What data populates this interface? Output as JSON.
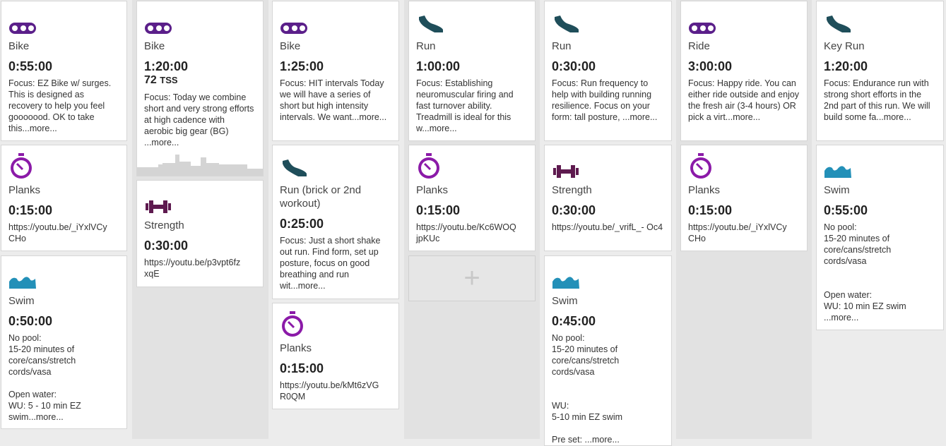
{
  "colors": {
    "bike": "#5b1f8a",
    "run": "#1f4e5a",
    "timer": "#8b1aa8",
    "strength": "#5e1a4f",
    "swim": "#2390b8"
  },
  "days": [
    {
      "cards": [
        {
          "icon": "bike-chain-icon",
          "title": "Bike",
          "duration": "0:55:00",
          "desc": "Focus: EZ Bike w/ surges. This is designed as recovery to help you feel gooooood. OK to take this",
          "more": "...more..."
        },
        {
          "icon": "stopwatch-icon",
          "title": "Planks",
          "duration": "0:15:00",
          "desc": "https://youtu.be/_iYxlVCy CHo"
        },
        {
          "icon": "swim-wave-icon",
          "title": "Swim",
          "duration": "0:50:00",
          "desc": "No pool:\n15-20 minutes of core/cans/stretch cords/vasa\n\nOpen water:\nWU: 5 - 10 min EZ swim",
          "more": "...more..."
        }
      ]
    },
    {
      "cards": [
        {
          "icon": "bike-chain-icon",
          "title": "Bike",
          "duration": "1:20:00",
          "tss": "72",
          "tss_unit": "TSS",
          "desc": "Focus: Today we combine short and very strong efforts at high cadence with aerobic big gear (BG) ",
          "more": "...more..."
        },
        {
          "icon": "dumbbell-icon",
          "title": "Strength",
          "duration": "0:30:00",
          "desc": "https://youtu.be/p3vpt6fz xqE"
        }
      ]
    },
    {
      "cards": [
        {
          "icon": "bike-chain-icon",
          "title": "Bike",
          "duration": "1:25:00",
          "desc": "Focus: HIT intervals Today we will have a series of short but high intensity intervals. We want",
          "more": "...more..."
        },
        {
          "icon": "run-shoe-icon",
          "title": "Run (brick or 2nd workout)",
          "duration": "0:25:00",
          "desc": "Focus: Just a short shake out run. Find form, set up posture, focus on good breathing and run wit",
          "more": "...more..."
        },
        {
          "icon": "stopwatch-icon",
          "title": "Planks",
          "duration": "0:15:00",
          "desc": "https://youtu.be/kMt6zVG R0QM"
        }
      ]
    },
    {
      "cards": [
        {
          "icon": "run-shoe-icon",
          "title": "Run",
          "duration": "1:00:00",
          "desc": "Focus: Establishing neuromuscular firing and fast turnover ability. Treadmill is ideal for this w",
          "more": "...more..."
        },
        {
          "icon": "stopwatch-icon",
          "title": "Planks",
          "duration": "0:15:00",
          "desc": "https://youtu.be/Kc6WOQ jpKUc"
        }
      ],
      "add_label": "+"
    },
    {
      "cards": [
        {
          "icon": "run-shoe-icon",
          "title": "Run",
          "duration": "0:30:00",
          "desc": "Focus: Run frequency to help with building running resilience. Focus on your form: tall posture, ",
          "more": "...more..."
        },
        {
          "icon": "dumbbell-icon",
          "title": "Strength",
          "duration": "0:30:00",
          "desc": "https://youtu.be/_vrifL_- Oc4"
        },
        {
          "icon": "swim-wave-icon",
          "title": "Swim",
          "duration": "0:45:00",
          "desc": "No pool:\n15-20 minutes of core/cans/stretch cords/vasa\n\n\nWU:\n5-10 min EZ swim\n\nPre set: ",
          "more": "...more..."
        }
      ]
    },
    {
      "cards": [
        {
          "icon": "bike-chain-icon",
          "title": "Ride",
          "duration": "3:00:00",
          "desc": "Focus: Happy ride. You can either ride outside and enjoy the fresh air (3-4 hours) OR pick a virt",
          "more": "...more..."
        },
        {
          "icon": "stopwatch-icon",
          "title": "Planks",
          "duration": "0:15:00",
          "desc": "https://youtu.be/_iYxlVCy CHo"
        }
      ]
    },
    {
      "cards": [
        {
          "icon": "run-shoe-icon",
          "title": "Key Run",
          "duration": "1:20:00",
          "desc": "Focus: Endurance run with strong short efforts in the 2nd part of this run. We will build some fa",
          "more": "...more..."
        },
        {
          "icon": "swim-wave-icon",
          "title": "Swim",
          "duration": "0:55:00",
          "desc": "No pool:\n15-20 minutes of core/cans/stretch cords/vasa\n\n\nOpen water:\nWU: 10 min EZ swim\n",
          "more": "...more..."
        }
      ]
    }
  ]
}
